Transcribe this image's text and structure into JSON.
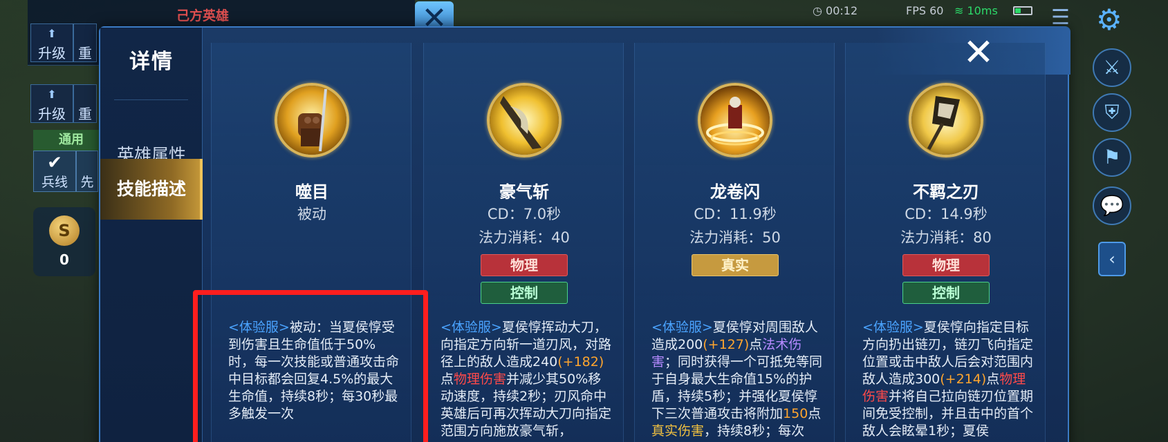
{
  "background": {
    "team_title": "己方英雄",
    "upgrade_label": "升级",
    "reset_label": "重置",
    "general_label": "通用",
    "soldier_label": "兵线",
    "vanguard_label": "先锋",
    "gold_count": "0",
    "time": "00:12",
    "fps": "FPS 60",
    "ping": "10ms"
  },
  "modal": {
    "close_label": "✕",
    "sidebar": {
      "title": "详情",
      "items": [
        {
          "label": "英雄属性",
          "active": false
        },
        {
          "label": "技能描述",
          "active": true
        }
      ]
    },
    "skills": [
      {
        "name": "噬目",
        "line1": "被动",
        "line2": "",
        "tags": [],
        "icon": "fist-icon",
        "desc": [
          {
            "t": "<体验服>",
            "c": "blue"
          },
          {
            "t": "被动：当夏侯惇受到伤害且生命值低于50%时，每一次技能或普通攻击命中目标都会回复4.5%的最大生命值，持续8秒；每30秒最多触发一次",
            "c": ""
          }
        ]
      },
      {
        "name": "豪气斩",
        "line1": "CD：7.0秒",
        "line2": "法力消耗：40",
        "tags": [
          {
            "label": "物理",
            "kind": "phys"
          },
          {
            "label": "控制",
            "kind": "ctrl"
          }
        ],
        "icon": "blade-slash-icon",
        "desc": [
          {
            "t": "<体验服>",
            "c": "blue"
          },
          {
            "t": "夏侯惇挥动大刀，向指定方向斩一道刃风，对路径上的敌人造成240",
            "c": ""
          },
          {
            "t": "(+182)",
            "c": "orange"
          },
          {
            "t": "点",
            "c": ""
          },
          {
            "t": "物理伤害",
            "c": "red"
          },
          {
            "t": "并减少其50%移动速度，持续2秒；刃风命中英雄后可再次挥动大刀向指定范围方向施放豪气斩，",
            "c": ""
          }
        ]
      },
      {
        "name": "龙卷闪",
        "line1": "CD：11.9秒",
        "line2": "法力消耗：50",
        "tags": [
          {
            "label": "真实",
            "kind": "true"
          }
        ],
        "icon": "whirlwind-icon",
        "desc": [
          {
            "t": "<体验服>",
            "c": "blue"
          },
          {
            "t": "夏侯惇对周围敌人造成200",
            "c": ""
          },
          {
            "t": "(+127)",
            "c": "orange"
          },
          {
            "t": "点",
            "c": ""
          },
          {
            "t": "法术伤害",
            "c": "purple"
          },
          {
            "t": "；同时获得一个可抵免等同于自身最大生命值15%的护盾，持续5秒；并强化夏侯惇下三次普通攻击将附加",
            "c": ""
          },
          {
            "t": "150",
            "c": "orange"
          },
          {
            "t": "点",
            "c": ""
          },
          {
            "t": "真实伤害",
            "c": "gold"
          },
          {
            "t": "，持续8秒；每次",
            "c": ""
          }
        ]
      },
      {
        "name": "不羁之刃",
        "line1": "CD：14.9秒",
        "line2": "法力消耗：80",
        "tags": [
          {
            "label": "物理",
            "kind": "phys"
          },
          {
            "label": "控制",
            "kind": "ctrl"
          }
        ],
        "icon": "chain-blade-icon",
        "desc": [
          {
            "t": "<体验服>",
            "c": "blue"
          },
          {
            "t": "夏侯惇向指定目标方向扔出链刃，链刃飞向指定位置或击中敌人后会对范围内敌人造成300",
            "c": ""
          },
          {
            "t": "(+214)",
            "c": "orange"
          },
          {
            "t": "点",
            "c": ""
          },
          {
            "t": "物理伤害",
            "c": "red"
          },
          {
            "t": "并将自己拉向链刃位置期间免受控制，并且击中的首个敌人会眩晕1秒；夏侯",
            "c": ""
          }
        ]
      }
    ]
  },
  "colors": {
    "highlight_box": "#ff1e1e",
    "modal_bg": "#15305a",
    "active_tab": "#c79a3a"
  }
}
